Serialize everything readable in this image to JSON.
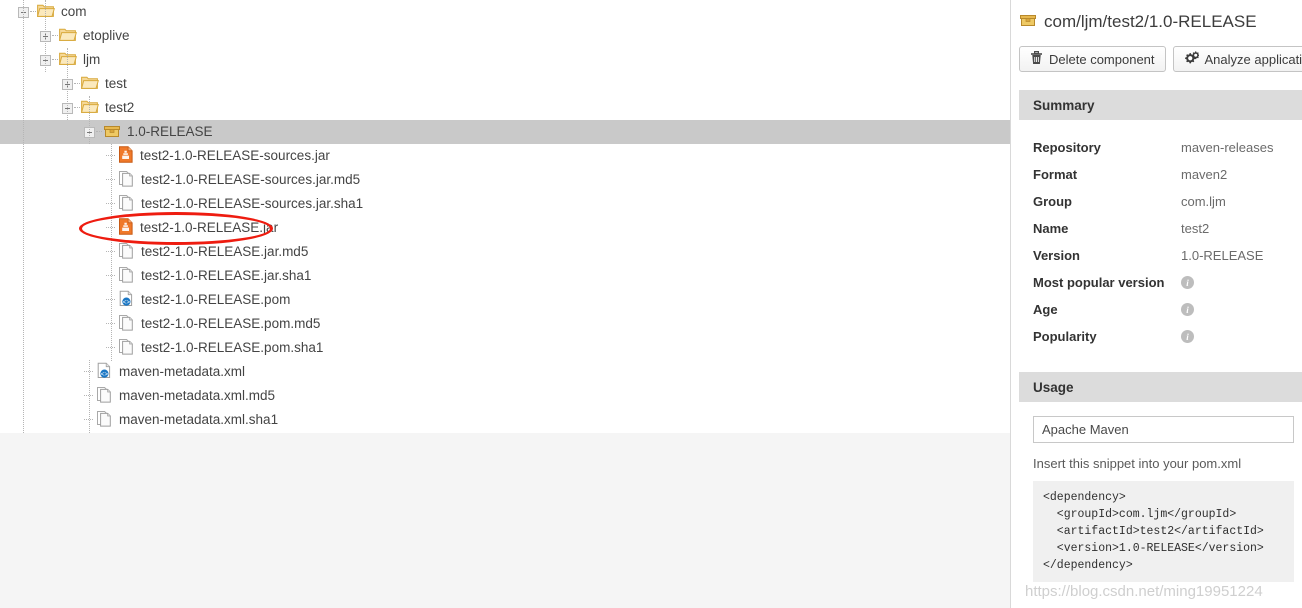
{
  "tree": {
    "rows": [
      {
        "id": "com",
        "label": "com",
        "depth": 0,
        "toggle": "minus",
        "icon": "folder-open-icon",
        "selected": false
      },
      {
        "id": "etoplive",
        "label": "etoplive",
        "depth": 1,
        "toggle": "plus",
        "icon": "folder-open-icon",
        "selected": false
      },
      {
        "id": "ljm",
        "label": "ljm",
        "depth": 1,
        "toggle": "minus",
        "icon": "folder-open-icon",
        "selected": false
      },
      {
        "id": "test",
        "label": "test",
        "depth": 2,
        "toggle": "plus",
        "icon": "folder-open-icon",
        "selected": false
      },
      {
        "id": "test2",
        "label": "test2",
        "depth": 2,
        "toggle": "minus",
        "icon": "folder-open-icon",
        "selected": false
      },
      {
        "id": "release",
        "label": "1.0-RELEASE",
        "depth": 3,
        "toggle": "minus",
        "icon": "package-icon",
        "selected": true
      },
      {
        "id": "src-jar",
        "label": "test2-1.0-RELEASE-sources.jar",
        "depth": 4,
        "toggle": "leaf",
        "icon": "jar-file-icon",
        "selected": false
      },
      {
        "id": "src-jar-md5",
        "label": "test2-1.0-RELEASE-sources.jar.md5",
        "depth": 4,
        "toggle": "leaf",
        "icon": "checksum-file-icon",
        "selected": false
      },
      {
        "id": "src-jar-sha1",
        "label": "test2-1.0-RELEASE-sources.jar.sha1",
        "depth": 4,
        "toggle": "leaf",
        "icon": "checksum-file-icon",
        "selected": false
      },
      {
        "id": "jar",
        "label": "test2-1.0-RELEASE.jar",
        "depth": 4,
        "toggle": "leaf",
        "icon": "jar-file-icon",
        "selected": false
      },
      {
        "id": "jar-md5",
        "label": "test2-1.0-RELEASE.jar.md5",
        "depth": 4,
        "toggle": "leaf",
        "icon": "checksum-file-icon",
        "selected": false
      },
      {
        "id": "jar-sha1",
        "label": "test2-1.0-RELEASE.jar.sha1",
        "depth": 4,
        "toggle": "leaf",
        "icon": "checksum-file-icon",
        "selected": false
      },
      {
        "id": "pom",
        "label": "test2-1.0-RELEASE.pom",
        "depth": 4,
        "toggle": "leaf",
        "icon": "xml-file-icon",
        "selected": false
      },
      {
        "id": "pom-md5",
        "label": "test2-1.0-RELEASE.pom.md5",
        "depth": 4,
        "toggle": "leaf",
        "icon": "checksum-file-icon",
        "selected": false
      },
      {
        "id": "pom-sha1",
        "label": "test2-1.0-RELEASE.pom.sha1",
        "depth": 4,
        "toggle": "leaf",
        "icon": "checksum-file-icon",
        "selected": false
      },
      {
        "id": "meta",
        "label": "maven-metadata.xml",
        "depth": 3,
        "toggle": "leaf",
        "icon": "xml-file-icon",
        "selected": false
      },
      {
        "id": "meta-md5",
        "label": "maven-metadata.xml.md5",
        "depth": 3,
        "toggle": "leaf",
        "icon": "checksum-file-icon",
        "selected": false
      },
      {
        "id": "meta-sha1",
        "label": "maven-metadata.xml.sha1",
        "depth": 3,
        "toggle": "leaf",
        "icon": "checksum-file-icon",
        "selected": false
      }
    ]
  },
  "annotation": {
    "shape": "ellipse",
    "color": "#ee1c10",
    "targets": "test2-1.0-RELEASE.jar"
  },
  "detail": {
    "title": "com/ljm/test2/1.0-RELEASE",
    "title_icon": "package-icon",
    "buttons": [
      {
        "id": "delete-component",
        "label": "Delete component",
        "icon": "trash-icon"
      },
      {
        "id": "analyze-application",
        "label": "Analyze application",
        "icon": "gears-icon"
      }
    ],
    "summary": {
      "heading": "Summary",
      "rows": [
        {
          "key": "Repository",
          "value": "maven-releases",
          "info": false
        },
        {
          "key": "Format",
          "value": "maven2",
          "info": false
        },
        {
          "key": "Group",
          "value": "com.ljm",
          "info": false
        },
        {
          "key": "Name",
          "value": "test2",
          "info": false
        },
        {
          "key": "Version",
          "value": "1.0-RELEASE",
          "info": false
        },
        {
          "key": "Most popular version",
          "value": "",
          "info": true
        },
        {
          "key": "Age",
          "value": "",
          "info": true
        },
        {
          "key": "Popularity",
          "value": "",
          "info": true
        }
      ]
    },
    "usage": {
      "heading": "Usage",
      "selected_tool": "Apache Maven",
      "hint": "Insert this snippet into your pom.xml",
      "snippet": "<dependency>\n  <groupId>com.ljm</groupId>\n  <artifactId>test2</artifactId>\n  <version>1.0-RELEASE</version>\n</dependency>"
    }
  },
  "watermark": "https://blog.csdn.net/ming19951224"
}
